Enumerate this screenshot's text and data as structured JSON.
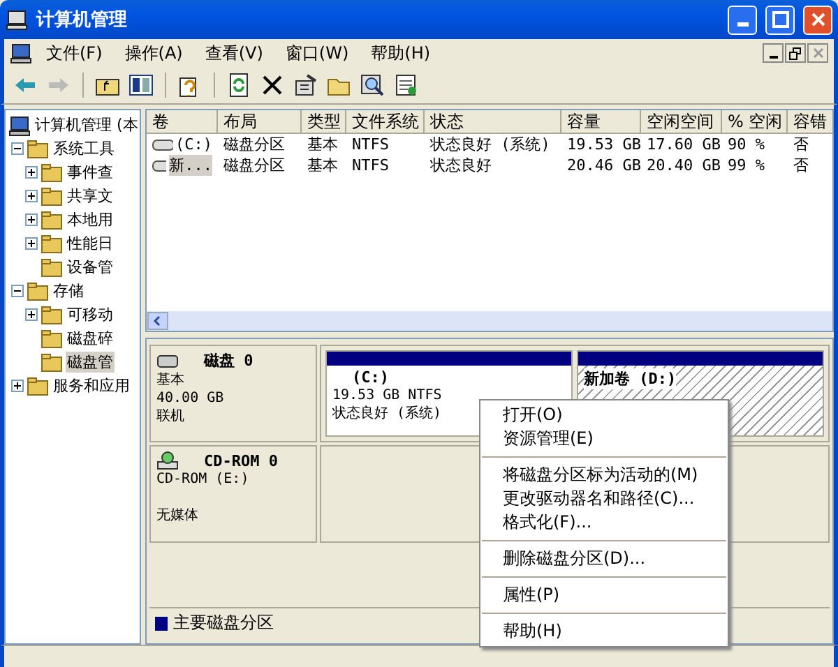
{
  "window": {
    "title": "计算机管理"
  },
  "menu": [
    "文件(F)",
    "操作(A)",
    "查看(V)",
    "窗口(W)",
    "帮助(H)"
  ],
  "tree": [
    {
      "label": "计算机管理 (本",
      "selected": false,
      "children": [
        {
          "label": "系统工具",
          "expanded": true,
          "selected": false,
          "children": [
            {
              "label": "事件查",
              "expanded": false,
              "selected": false
            },
            {
              "label": "共享文",
              "expanded": false,
              "selected": false
            },
            {
              "label": "本地用",
              "expanded": false,
              "selected": false
            },
            {
              "label": "性能日",
              "expanded": false,
              "selected": false
            },
            {
              "label": "设备管",
              "selected": false
            }
          ]
        },
        {
          "label": "存储",
          "expanded": true,
          "selected": false,
          "children": [
            {
              "label": "可移动",
              "expanded": false,
              "selected": false
            },
            {
              "label": "磁盘碎",
              "selected": false
            },
            {
              "label": "磁盘管",
              "selected": true
            }
          ]
        },
        {
          "label": "服务和应用",
          "expanded": false,
          "selected": false
        }
      ]
    }
  ],
  "table": {
    "columns": [
      "卷",
      "布局",
      "类型",
      "文件系统",
      "状态",
      "容量",
      "空闲空间",
      "% 空闲",
      "容错"
    ],
    "rows": [
      {
        "selected": false,
        "cells": [
          "(C:)",
          "磁盘分区",
          "基本",
          "NTFS",
          "状态良好 (系统)",
          "19.53 GB",
          "17.60 GB",
          "90 %",
          "否"
        ]
      },
      {
        "selected": true,
        "cells": [
          "新...",
          "磁盘分区",
          "基本",
          "NTFS",
          "状态良好",
          "20.46 GB",
          "20.40 GB",
          "99 %",
          "否"
        ]
      }
    ]
  },
  "disks": [
    {
      "kind": "disk",
      "name": "磁盘 0",
      "lines": [
        "基本",
        "40.00 GB",
        "联机"
      ],
      "partitions": [
        {
          "name": "(C:)",
          "lines": [
            "19.53 GB NTFS",
            "状态良好 (系统)"
          ],
          "selected": false
        },
        {
          "name": "新加卷  (D:)",
          "selected": true
        }
      ]
    },
    {
      "kind": "cdrom",
      "name": "CD-ROM 0",
      "lines": [
        "CD-ROM (E:)",
        "无媒体"
      ]
    }
  ],
  "legend": {
    "label": "主要磁盘分区",
    "color": "#000080"
  },
  "context_menu": [
    {
      "kind": "item",
      "label": "打开(O)"
    },
    {
      "kind": "item",
      "label": "资源管理(E)"
    },
    {
      "kind": "separator"
    },
    {
      "kind": "item",
      "label": "将磁盘分区标为活动的(M)"
    },
    {
      "kind": "item",
      "label": "更改驱动器名和路径(C)..."
    },
    {
      "kind": "item",
      "label": "格式化(F)..."
    },
    {
      "kind": "separator"
    },
    {
      "kind": "item",
      "label": "删除磁盘分区(D)..."
    },
    {
      "kind": "separator"
    },
    {
      "kind": "item",
      "label": "属性(P)"
    },
    {
      "kind": "separator"
    },
    {
      "kind": "item",
      "label": "帮助(H)"
    }
  ]
}
